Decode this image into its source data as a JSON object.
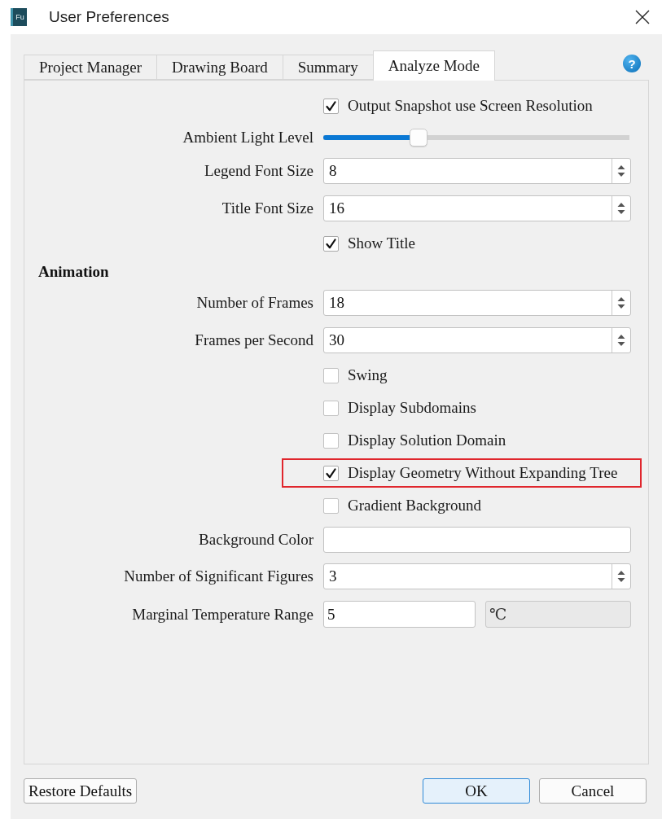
{
  "window": {
    "app_icon": "Fu",
    "title": "User Preferences"
  },
  "tabs": [
    {
      "label": "Project Manager",
      "selected": false
    },
    {
      "label": "Drawing Board",
      "selected": false
    },
    {
      "label": "Summary",
      "selected": false
    },
    {
      "label": "Analyze Mode",
      "selected": true
    }
  ],
  "help": {
    "label": "?"
  },
  "settings": [
    {
      "kind": "checkbox",
      "label": "Output Snapshot use Screen Resolution",
      "checked": true,
      "highlighted": false
    },
    {
      "kind": "slider",
      "label": "Ambient Light Level",
      "level": 0.31
    },
    {
      "kind": "spinbox",
      "label": "Legend Font Size",
      "value": "8"
    },
    {
      "kind": "spinbox",
      "label": "Title Font Size",
      "value": "16"
    },
    {
      "kind": "checkbox",
      "label": "Show Title",
      "checked": true,
      "highlighted": false
    },
    {
      "kind": "heading",
      "label": "Animation"
    },
    {
      "kind": "spinbox",
      "label": "Number of Frames",
      "value": "18"
    },
    {
      "kind": "spinbox",
      "label": "Frames per Second",
      "value": "30"
    },
    {
      "kind": "checkbox",
      "label": "Swing",
      "checked": false,
      "highlighted": false
    },
    {
      "kind": "checkbox",
      "label": "Display Subdomains",
      "checked": false,
      "highlighted": false
    },
    {
      "kind": "checkbox",
      "label": "Display Solution Domain",
      "checked": false,
      "highlighted": false
    },
    {
      "kind": "checkbox",
      "label": "Display Geometry Without Expanding Tree",
      "checked": true,
      "highlighted": true
    },
    {
      "kind": "checkbox",
      "label": "Gradient Background",
      "checked": false,
      "highlighted": false
    },
    {
      "kind": "text",
      "label": "Background Color"
    },
    {
      "kind": "spinbox",
      "label": "Number of Significant Figures",
      "value": "3"
    },
    {
      "kind": "unit_field",
      "label": "Marginal Temperature Range",
      "value": "5",
      "unit": "℃"
    }
  ],
  "buttons": {
    "left": [
      {
        "label": "Restore Defaults",
        "focused": false
      }
    ],
    "right": [
      {
        "label": "OK",
        "focused": true
      },
      {
        "label": "Cancel",
        "focused": false
      }
    ]
  }
}
